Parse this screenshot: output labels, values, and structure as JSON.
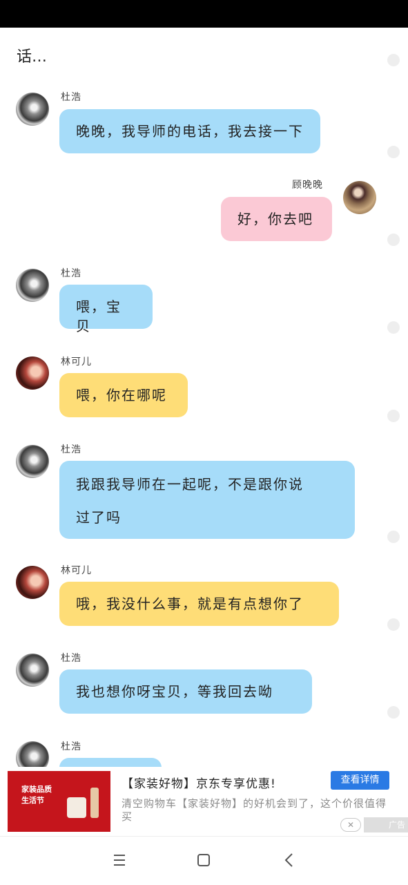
{
  "top_fragment": "话…",
  "messages": [
    {
      "sender": "杜浩",
      "text": "晚晚，我导师的电话，我去接一下",
      "side": "left",
      "color": "#a6dcf9"
    },
    {
      "sender": "顾晚晚",
      "text": "好，你去吧",
      "side": "right",
      "color": "#fbc9d5"
    },
    {
      "sender": "杜浩",
      "text": "喂，宝贝",
      "side": "left",
      "color": "#a6dcf9"
    },
    {
      "sender": "林可儿",
      "text": "喂，你在哪呢",
      "side": "left",
      "color": "#fedd77"
    },
    {
      "sender": "杜浩",
      "line1": "我跟我导师在一起呢，不是跟你说",
      "line2": "过了吗",
      "side": "left",
      "color": "#a6dcf9"
    },
    {
      "sender": "林可儿",
      "text": "哦，我没什么事，就是有点想你了",
      "side": "left",
      "color": "#fedd77"
    },
    {
      "sender": "杜浩",
      "text": "我也想你呀宝贝，等我回去呦",
      "side": "left",
      "color": "#a6dcf9"
    },
    {
      "sender": "杜浩",
      "text": "",
      "side": "left",
      "color": "#a6dcf9"
    }
  ],
  "ad": {
    "image_line1": "家装品质",
    "image_line2": "生活节",
    "title": "【家装好物】京东专享优惠!",
    "button": "查看详情",
    "description": "清空购物车【家装好物】的好机会到了，这个价很值得买",
    "close": "✕",
    "tag": "广告"
  },
  "icons": {
    "menu": "menu-icon",
    "home": "home-icon",
    "back": "back-icon"
  }
}
